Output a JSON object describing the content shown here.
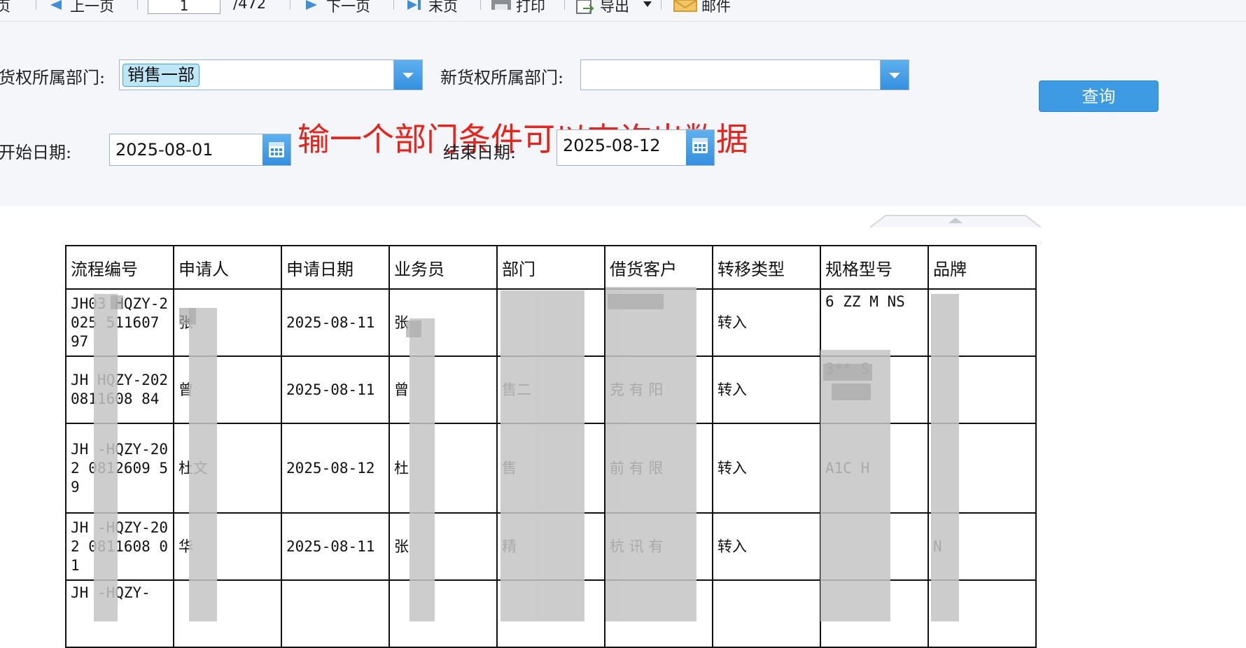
{
  "toolbar": {
    "first_page_tail": "页",
    "prev_page": "上一页",
    "current_page": "1",
    "total_pages": "/472",
    "next_page": "下一页",
    "last_page": "末页",
    "print": "打印",
    "export": "导出",
    "mail": "邮件"
  },
  "query": {
    "old_dept_label": "货权所属部门:",
    "old_dept_value": "销售一部",
    "new_dept_label": "新货权所属部门:",
    "new_dept_value": "",
    "start_label": "开始日期:",
    "start_value": "2025-08-01",
    "end_label": "结束日期:",
    "end_value": "2025-08-12",
    "search_button": "查询",
    "annotation": "输一个部门条件可以查询出数据"
  },
  "colors": {
    "accent": "#3d9be4",
    "annotation": "#e8231c",
    "tag_bg": "#bfe6f7",
    "panel_bg": "#f4f6f9"
  },
  "table": {
    "headers": [
      "流程编号",
      "申请人",
      "申请日期",
      "业务员",
      "部门",
      "借货客户",
      "转移类型",
      "规格型号",
      "品牌"
    ],
    "rows": [
      {
        "flow": "JH03 HQZY-2025 511607 97",
        "applicant": "张",
        "date": "2025-08-11",
        "sales": "张",
        "dept": "",
        "customer": "",
        "type": "转入",
        "model": "6 ZZ M NS",
        "brand": ""
      },
      {
        "flow": "JH HQZY-202 0811608 84",
        "applicant": "曾",
        "date": "2025-08-11",
        "sales": "曾",
        "dept": "售二",
        "customer": "克 有 阳",
        "type": "转入",
        "model": "3**  S",
        "brand": ""
      },
      {
        "flow": "JH -HQZY-202 0812609 59",
        "applicant": "杜文",
        "date": "2025-08-12",
        "sales": "杜",
        "dept": "售",
        "customer": "前 有 限",
        "type": "转入",
        "model": "A1C H",
        "brand": ""
      },
      {
        "flow": "JH -HQZY-202 0811608 01",
        "applicant": "华",
        "date": "2025-08-11",
        "sales": "张",
        "dept": "精",
        "customer": "杭 讯 有",
        "type": "转入",
        "model": "",
        "brand": "N"
      },
      {
        "flow": "JH -HQZY-",
        "applicant": "",
        "date": "",
        "sales": "",
        "dept": "",
        "customer": "",
        "type": "",
        "model": "",
        "brand": ""
      }
    ]
  }
}
